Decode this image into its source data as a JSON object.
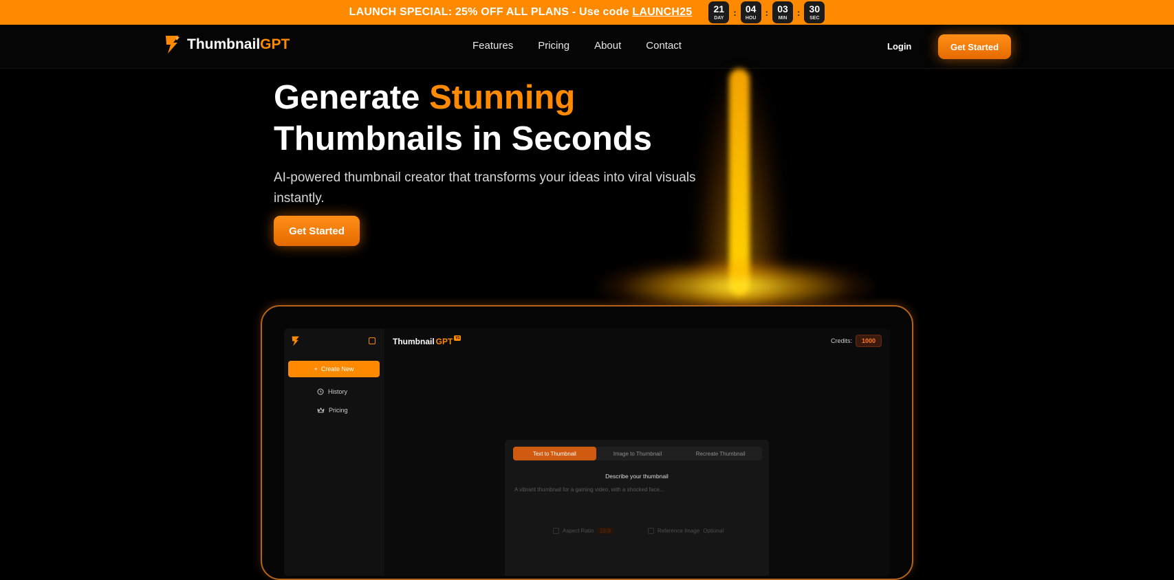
{
  "promo": {
    "text": "LAUNCH SPECIAL: 25% OFF ALL PLANS - Use code ",
    "code": "LAUNCH25",
    "countdown": [
      {
        "value": "21",
        "unit": "DAY"
      },
      {
        "value": "04",
        "unit": "HOU"
      },
      {
        "value": "03",
        "unit": "MIN"
      },
      {
        "value": "30",
        "unit": "SEC"
      }
    ],
    "separator": ":"
  },
  "nav": {
    "brand_main": "Thumbnail",
    "brand_accent": "GPT",
    "links": [
      "Features",
      "Pricing",
      "About",
      "Contact"
    ],
    "login": "Login",
    "cta": "Get Started"
  },
  "hero": {
    "title_part1": "Generate ",
    "title_highlight": "Stunning",
    "title_line2": "Thumbnails in Seconds",
    "subtitle": "AI-powered thumbnail creator that transforms your ideas into viral visuals instantly.",
    "cta": "Get Started"
  },
  "app": {
    "title_main": "Thumbnail",
    "title_accent": "GPT",
    "badge": "V1",
    "credits_label": "Credits:",
    "credits_value": "1000",
    "sidebar": {
      "create": "Create New",
      "items": [
        "History",
        "Pricing"
      ]
    },
    "tabs": [
      "Text to Thumbnail",
      "Image to Thumbnail",
      "Recreate Thumbnail"
    ],
    "describe_label": "Describe your thumbnail",
    "placeholder": "A vibrant thumbnail for a gaming video, with a shocked face...",
    "option_aspect": "Aspect Ratio",
    "option_aspect_value": "16:9",
    "option_reference": "Reference Image",
    "option_reference_note": "Optional"
  },
  "colors": {
    "accent": "#ff8a00",
    "background": "#000000"
  }
}
